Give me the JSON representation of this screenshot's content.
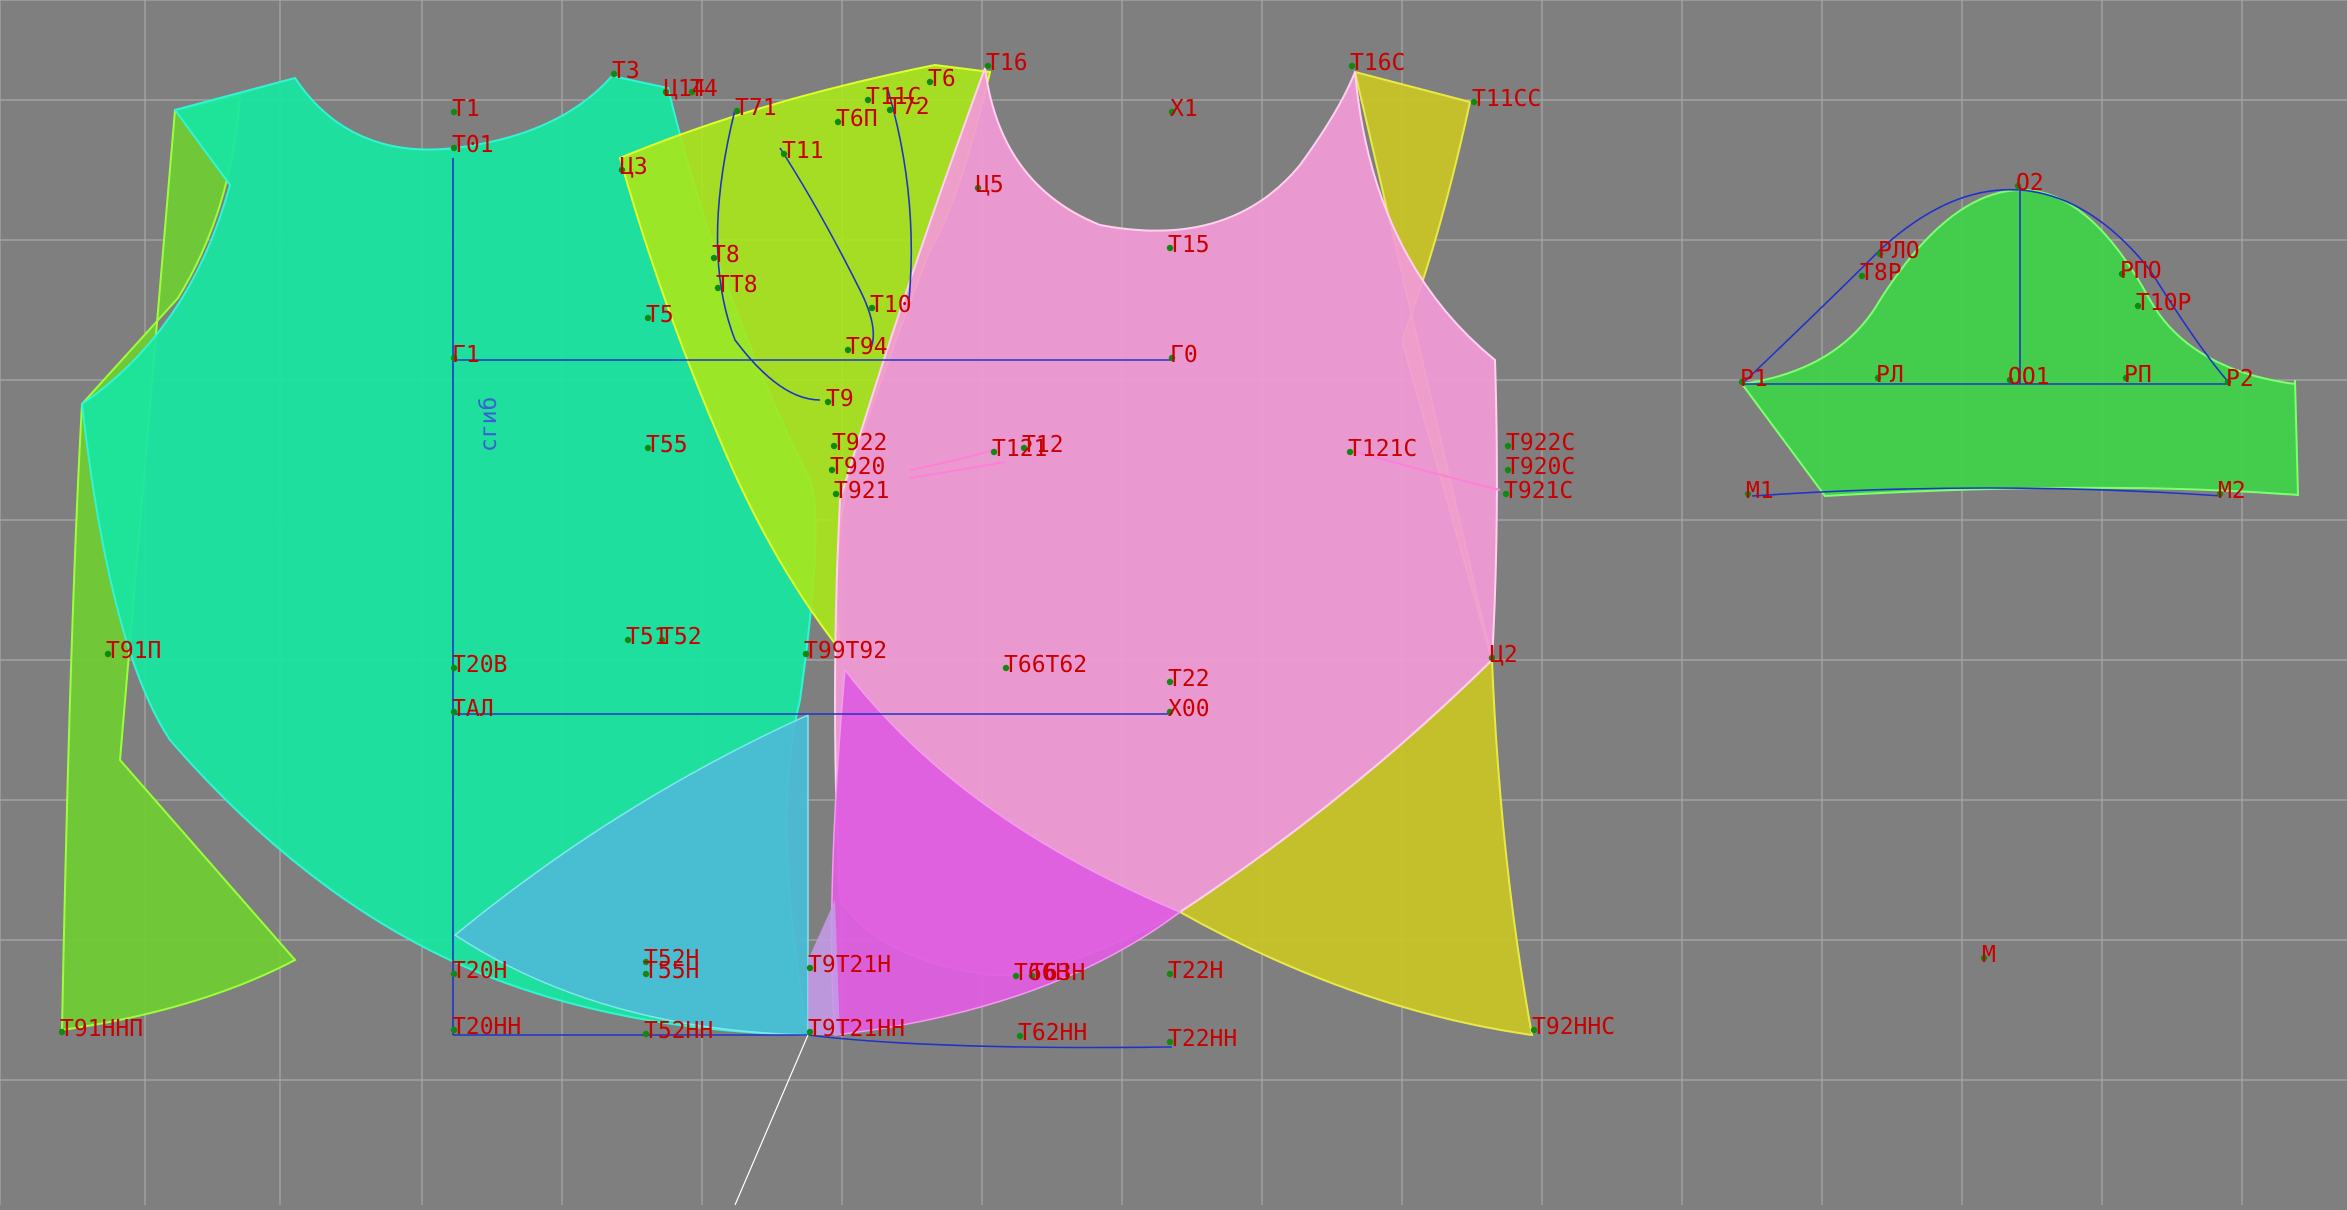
{
  "colors": {
    "background": "#7f7f7f",
    "grid": "#a9a9a9",
    "label": "#c80000",
    "construction_line": "#1f33c8",
    "point": "#0f8a0f",
    "back_piece": "#18e6a0",
    "front_piece": "#f29ad6",
    "yoke_piece": "#a8e81a",
    "side_piece_left": "#6fce32",
    "side_piece_right": "#c7c427",
    "sleeve_piece": "#41d24b",
    "hem_overlap_cyan": "#4cbcd6",
    "hem_overlap_magenta": "#de5ee0"
  },
  "labels": [
    {
      "id": "t1",
      "text": "Т1"
    },
    {
      "id": "t01",
      "text": "Т01"
    },
    {
      "id": "t3",
      "text": "Т3"
    },
    {
      "id": "c14",
      "text": "Ц14"
    },
    {
      "id": "t4",
      "text": "Т4"
    },
    {
      "id": "t71",
      "text": "Т71"
    },
    {
      "id": "t11c",
      "text": "Т11С"
    },
    {
      "id": "t6",
      "text": "Т6"
    },
    {
      "id": "t16",
      "text": "Т16"
    },
    {
      "id": "t6p",
      "text": "Т6П"
    },
    {
      "id": "t72",
      "text": "Т72"
    },
    {
      "id": "x1",
      "text": "Х1"
    },
    {
      "id": "t16c",
      "text": "Т16С"
    },
    {
      "id": "t11cc",
      "text": "Т11СС"
    },
    {
      "id": "c3",
      "text": "Ц3"
    },
    {
      "id": "t11",
      "text": "Т11"
    },
    {
      "id": "c5",
      "text": "Ц5"
    },
    {
      "id": "t15",
      "text": "Т15"
    },
    {
      "id": "t8",
      "text": "Т8"
    },
    {
      "id": "tt8",
      "text": "ТТ8"
    },
    {
      "id": "t5",
      "text": "Т5"
    },
    {
      "id": "t10",
      "text": "Т10"
    },
    {
      "id": "g1",
      "text": "Г1"
    },
    {
      "id": "t94",
      "text": "Т94"
    },
    {
      "id": "g0",
      "text": "Г0"
    },
    {
      "id": "t9",
      "text": "Т9"
    },
    {
      "id": "fold",
      "text": "сгиб"
    },
    {
      "id": "t55",
      "text": "Т55"
    },
    {
      "id": "t922",
      "text": "Т922"
    },
    {
      "id": "t920",
      "text": "Т920"
    },
    {
      "id": "t921",
      "text": "Т921"
    },
    {
      "id": "t121",
      "text": "Т121"
    },
    {
      "id": "t12",
      "text": "Т12"
    },
    {
      "id": "t121c",
      "text": "Т121С"
    },
    {
      "id": "t922c",
      "text": "Т922С"
    },
    {
      "id": "t920c",
      "text": "Т920С"
    },
    {
      "id": "t921c",
      "text": "Т921С"
    },
    {
      "id": "t91p",
      "text": "Т91П"
    },
    {
      "id": "t20v",
      "text": "Т20В"
    },
    {
      "id": "t51",
      "text": "Т51"
    },
    {
      "id": "t52",
      "text": "Т52"
    },
    {
      "id": "t9992",
      "text": "Т99Т92"
    },
    {
      "id": "t6662",
      "text": "Т66Т62"
    },
    {
      "id": "t22",
      "text": "Т22"
    },
    {
      "id": "c2",
      "text": "Ц2"
    },
    {
      "id": "tal",
      "text": "ТАЛ"
    },
    {
      "id": "x00",
      "text": "Х00"
    },
    {
      "id": "t20n",
      "text": "Т20Н"
    },
    {
      "id": "t55n",
      "text": "Т55Н"
    },
    {
      "id": "t52n",
      "text": "Т52Н"
    },
    {
      "id": "t921n",
      "text": "Т9Т21Н"
    },
    {
      "id": "t66n",
      "text": "Т66Н"
    },
    {
      "id": "t62n",
      "text": "Т63Н"
    },
    {
      "id": "t22n",
      "text": "Т22Н"
    },
    {
      "id": "t91nnp",
      "text": "Т91ННП"
    },
    {
      "id": "t20nn",
      "text": "Т20НН"
    },
    {
      "id": "t52nn",
      "text": "Т52НН"
    },
    {
      "id": "t921nn",
      "text": "Т9Т21НН"
    },
    {
      "id": "t62nn",
      "text": "Т62НН"
    },
    {
      "id": "t22nn",
      "text": "Т22НН"
    },
    {
      "id": "t92nnc",
      "text": "Т92ННС"
    },
    {
      "id": "o2",
      "text": "О2"
    },
    {
      "id": "rlo",
      "text": "РЛО"
    },
    {
      "id": "t8p",
      "text": "Т8Р"
    },
    {
      "id": "rpo",
      "text": "РПО"
    },
    {
      "id": "t10p",
      "text": "Т10Р"
    },
    {
      "id": "r1",
      "text": "Р1"
    },
    {
      "id": "rl",
      "text": "РЛ"
    },
    {
      "id": "o01",
      "text": "ОО1"
    },
    {
      "id": "rp",
      "text": "РП"
    },
    {
      "id": "r2",
      "text": "Р2"
    },
    {
      "id": "m1",
      "text": "М1"
    },
    {
      "id": "m2",
      "text": "М2"
    },
    {
      "id": "m",
      "text": "М"
    }
  ]
}
